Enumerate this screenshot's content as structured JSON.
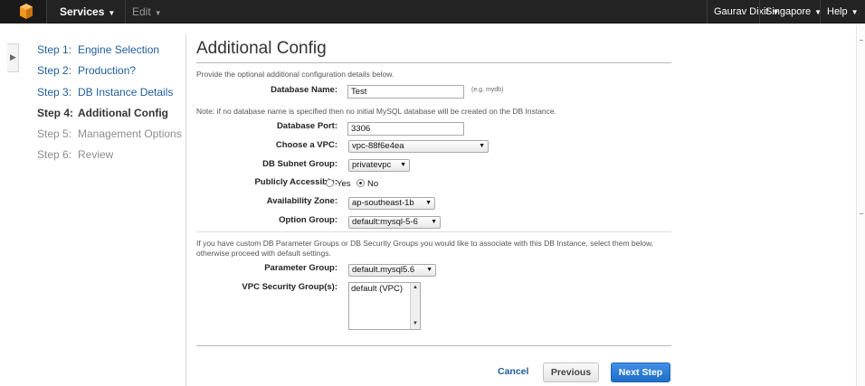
{
  "header": {
    "services_label": "Services",
    "edit_label": "Edit",
    "user_label": "Gaurav Dixit",
    "region_label": "Singapore",
    "help_label": "Help",
    "logo_icon": "aws-cube-icon",
    "caret_icon": "chevron-down-icon",
    "brand_color": "#f29720"
  },
  "steps": [
    {
      "num": "Step 1:",
      "label": "Engine Selection",
      "state": "link"
    },
    {
      "num": "Step 2:",
      "label": "Production?",
      "state": "link"
    },
    {
      "num": "Step 3:",
      "label": "DB Instance Details",
      "state": "link"
    },
    {
      "num": "Step 4:",
      "label": "Additional Config",
      "state": "current"
    },
    {
      "num": "Step 5:",
      "label": "Management Options",
      "state": "disabled"
    },
    {
      "num": "Step 6:",
      "label": "Review",
      "state": "disabled"
    }
  ],
  "form": {
    "title": "Additional Config",
    "intro": "Provide the optional additional configuration details below.",
    "db_name_label": "Database Name:",
    "db_name_value": "Test",
    "db_name_hint": "(e.g. mydb)",
    "db_name_note": "Note: if no database name is specified then no initial MySQL database will be created on the DB Instance.",
    "port_label": "Database Port:",
    "port_value": "3306",
    "vpc_label": "Choose a VPC:",
    "vpc_value": "vpc-88f6e4ea",
    "subnet_label": "DB Subnet Group:",
    "subnet_value": "privatevpc",
    "public_label": "Publicly Accessible:",
    "public_yes": "Yes",
    "public_no": "No",
    "public_selected": "No",
    "az_label": "Availability Zone:",
    "az_value": "ap-southeast-1b",
    "option_group_label": "Option Group:",
    "option_group_value": "default:mysql-5-6",
    "param_note": "If you have custom DB Parameter Groups or DB Security Groups you would like to associate with this DB Instance, select them below, otherwise proceed with default settings.",
    "param_group_label": "Parameter Group:",
    "param_group_value": "default.mysql5.6",
    "sg_label": "VPC Security Group(s):",
    "sg_options": [
      "default (VPC)"
    ]
  },
  "actions": {
    "cancel_label": "Cancel",
    "previous_label": "Previous",
    "next_label": "Next Step",
    "primary_color": "#1f6dc6"
  }
}
